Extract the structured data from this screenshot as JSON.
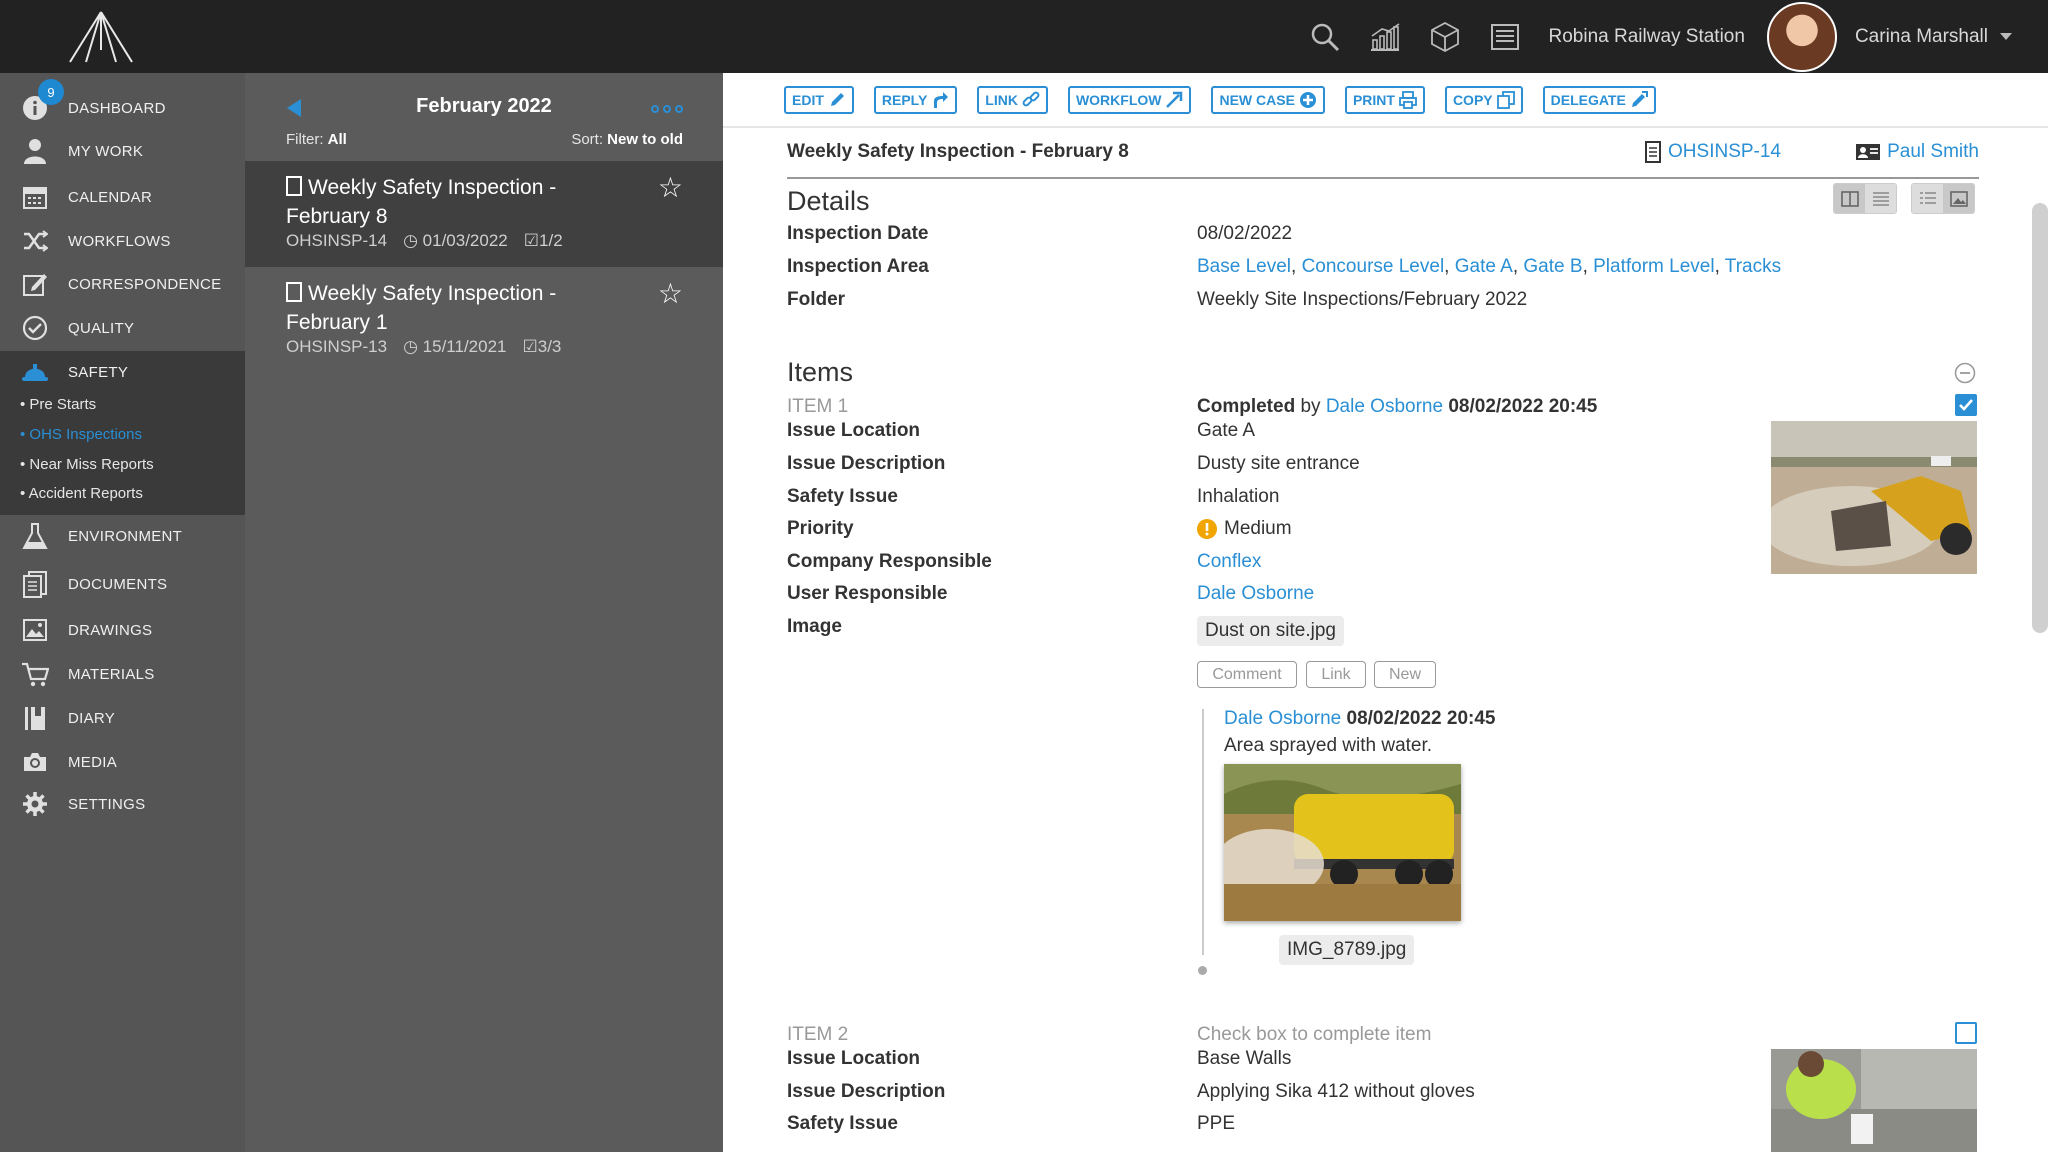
{
  "topbar": {
    "station": "Robina Railway Station",
    "user": "Carina Marshall",
    "icons": [
      "search-icon",
      "chart-icon",
      "3d-model-icon",
      "list-icon"
    ]
  },
  "sidebar": {
    "badge": "9",
    "items": [
      {
        "label": "DASHBOARD",
        "icon": "info-icon"
      },
      {
        "label": "MY WORK",
        "icon": "person-icon"
      },
      {
        "label": "CALENDAR",
        "icon": "calendar-icon"
      },
      {
        "label": "WORKFLOWS",
        "icon": "shuffle-icon"
      },
      {
        "label": "CORRESPONDENCE",
        "icon": "edit-icon"
      },
      {
        "label": "QUALITY",
        "icon": "check-circle-icon"
      },
      {
        "label": "SAFETY",
        "icon": "hard-hat-icon"
      },
      {
        "label": "ENVIRONMENT",
        "icon": "flask-icon"
      },
      {
        "label": "DOCUMENTS",
        "icon": "documents-icon"
      },
      {
        "label": "DRAWINGS",
        "icon": "image-icon"
      },
      {
        "label": "MATERIALS",
        "icon": "cart-icon"
      },
      {
        "label": "DIARY",
        "icon": "diary-icon"
      },
      {
        "label": "MEDIA",
        "icon": "camera-icon"
      },
      {
        "label": "SETTINGS",
        "icon": "gear-icon"
      }
    ],
    "safety_sub": [
      {
        "label": "• Pre Starts"
      },
      {
        "label": "• OHS Inspections"
      },
      {
        "label": "• Near Miss Reports"
      },
      {
        "label": "• Accident Reports"
      }
    ]
  },
  "list": {
    "title": "February 2022",
    "filter_label": "Filter:",
    "filter_value": "All",
    "sort_label": "Sort:",
    "sort_value": "New to old",
    "cards": [
      {
        "title": "Weekly Safety Inspection - February 8",
        "ref": "OHSINSP-14",
        "date": "01/03/2022",
        "count": "1/2"
      },
      {
        "title": "Weekly Safety Inspection - February 1",
        "ref": "OHSINSP-13",
        "date": "15/11/2021",
        "count": "3/3"
      }
    ]
  },
  "toolbar": {
    "buttons": [
      {
        "label": "EDIT",
        "icon": "pencil-icon"
      },
      {
        "label": "REPLY",
        "icon": "reply-icon"
      },
      {
        "label": "LINK",
        "icon": "link-icon"
      },
      {
        "label": "WORKFLOW",
        "icon": "external-icon"
      },
      {
        "label": "NEW CASE",
        "icon": "plus-circle-icon"
      },
      {
        "label": "PRINT",
        "icon": "print-icon"
      },
      {
        "label": "COPY",
        "icon": "copy-icon"
      },
      {
        "label": "DELEGATE",
        "icon": "delegate-icon"
      }
    ]
  },
  "record": {
    "title": "Weekly Safety Inspection - February 8",
    "ref": "OHSINSP-14",
    "owner": "Paul Smith",
    "details_heading": "Details",
    "details": {
      "date_label": "Inspection Date",
      "date_value": "08/02/2022",
      "area_label": "Inspection Area",
      "areas": [
        "Base Level",
        "Concourse Level",
        "Gate A",
        "Gate B",
        "Platform Level",
        "Tracks"
      ],
      "folder_label": "Folder",
      "folder_value": "Weekly Site Inspections/February 2022"
    },
    "items_heading": "Items",
    "item1": {
      "no": "ITEM 1",
      "completed_label": "Completed",
      "by": "by",
      "completed_by": "Dale Osborne",
      "completed_at": "08/02/2022 20:45",
      "location_label": "Issue Location",
      "location": "Gate A",
      "description_label": "Issue Description",
      "description": "Dusty site entrance",
      "safety_label": "Safety Issue",
      "safety": "Inhalation",
      "priority_label": "Priority",
      "priority": "Medium",
      "company_label": "Company Responsible",
      "company": "Conflex",
      "user_label": "User Responsible",
      "user": "Dale Osborne",
      "image_label": "Image",
      "image": "Dust on site.jpg",
      "actions": [
        "Comment",
        "Link",
        "New"
      ],
      "comment_author": "Dale Osborne",
      "comment_time": "08/02/2022 20:45",
      "comment_text": "Area sprayed with water.",
      "comment_image": "IMG_8789.jpg",
      "checked": true
    },
    "item2": {
      "no": "ITEM 2",
      "hint": "Check box to complete item",
      "location_label": "Issue Location",
      "location": "Base Walls",
      "description_label": "Issue Description",
      "description": "Applying Sika 412 without gloves",
      "safety_label": "Safety Issue",
      "safety": "PPE",
      "checked": false
    }
  },
  "colors": {
    "accent": "#2a8fd4",
    "topbar": "#222222",
    "sidebar": "#555555",
    "list": "#5b5b5b",
    "priority_medium": "#f0a500"
  }
}
